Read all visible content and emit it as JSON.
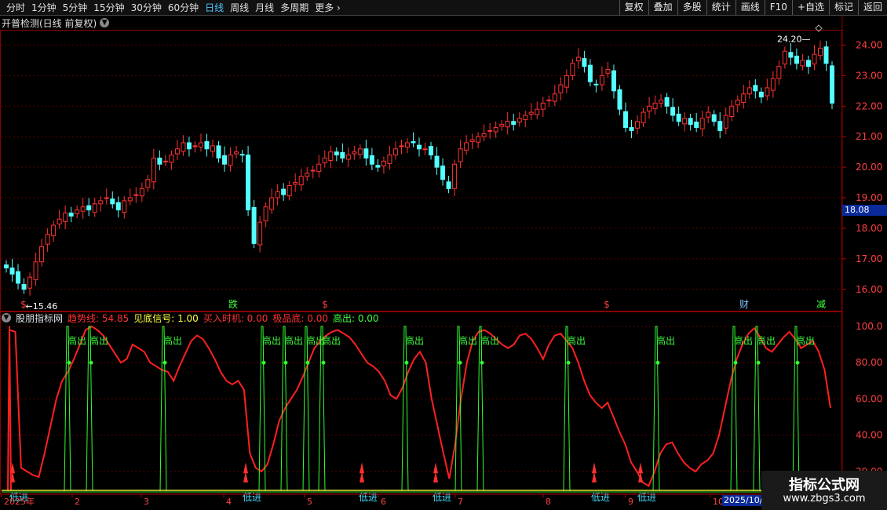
{
  "toolbar": {
    "periods": [
      "分时",
      "1分钟",
      "5分钟",
      "15分钟",
      "30分钟",
      "60分钟",
      "日线",
      "周线",
      "月线",
      "多周期",
      "更多"
    ],
    "selected_period": "日线",
    "tools": [
      "复权",
      "叠加",
      "多股",
      "统计",
      "画线",
      "F10",
      "+自选",
      "标记",
      "返回"
    ]
  },
  "title": {
    "name": "开普检测(日线 前复权)"
  },
  "price_axis": {
    "labels": [
      "24.00",
      "23.00",
      "22.00",
      "21.00",
      "20.00",
      "19.00",
      "18.00",
      "17.00",
      "16.00"
    ],
    "current_price": "18.08"
  },
  "annotations": {
    "high": "24.20",
    "low": "15.46"
  },
  "event_markers": [
    "$",
    "跌",
    "$",
    "$",
    "财",
    "减"
  ],
  "indicator": {
    "name": "股朋指标网",
    "fields": [
      {
        "label": "趋势线:",
        "value": "54.85",
        "color": "#ff3030"
      },
      {
        "label": "见底信号:",
        "value": "1.00",
        "color": "#ffff40"
      },
      {
        "label": "买入时机:",
        "value": "0.00",
        "color": "#ff3030"
      },
      {
        "label": "极品底:",
        "value": "0.00",
        "color": "#ff3030"
      },
      {
        "label": "高出:",
        "value": "0.00",
        "color": "#40ff40"
      }
    ],
    "axis_labels": [
      "100.0",
      "80.00",
      "60.00",
      "40.00",
      "20.00"
    ],
    "high_label": "高出",
    "low_label": "低进"
  },
  "date_axis": {
    "labels": [
      "2025年",
      "2",
      "3",
      "4",
      "5",
      "6",
      "7",
      "8",
      "9",
      "10"
    ],
    "current": "2025/10/"
  },
  "watermark": {
    "title": "指标公式网",
    "url": "www.zbgs3.com"
  },
  "chart_data": {
    "type": "candlestick",
    "price_range": [
      15.3,
      24.5
    ],
    "indicator_range": [
      10,
      100
    ],
    "closes": [
      16.7,
      16.5,
      16.2,
      16.0,
      16.4,
      16.9,
      17.4,
      17.8,
      18.1,
      18.3,
      18.5,
      18.4,
      18.6,
      18.7,
      18.6,
      18.8,
      18.9,
      19.0,
      18.8,
      18.6,
      18.9,
      19.0,
      19.1,
      19.3,
      19.6,
      20.3,
      20.1,
      20.2,
      20.4,
      20.6,
      20.8,
      20.6,
      20.7,
      20.8,
      20.6,
      20.7,
      20.3,
      20.1,
      20.4,
      20.5,
      20.4,
      18.6,
      17.5,
      18.2,
      18.7,
      19.0,
      19.2,
      19.1,
      19.4,
      19.5,
      19.7,
      19.8,
      19.9,
      20.1,
      20.3,
      20.5,
      20.4,
      20.3,
      20.4,
      20.5,
      20.6,
      20.3,
      20.1,
      20.0,
      20.2,
      20.4,
      20.6,
      20.7,
      20.8,
      20.8,
      20.6,
      20.6,
      20.4,
      20.0,
      19.6,
      19.3,
      20.1,
      20.6,
      20.8,
      20.9,
      21.0,
      21.1,
      21.2,
      21.3,
      21.4,
      21.5,
      21.4,
      21.6,
      21.7,
      21.8,
      21.9,
      22.1,
      22.2,
      22.4,
      22.7,
      23.0,
      23.4,
      23.6,
      23.3,
      22.8,
      22.7,
      23.0,
      23.2,
      22.5,
      21.9,
      21.3,
      21.2,
      21.5,
      21.8,
      22.0,
      22.1,
      22.2,
      22.0,
      21.7,
      21.5,
      21.6,
      21.4,
      21.3,
      21.6,
      21.8,
      21.5,
      21.2,
      21.7,
      22.0,
      22.2,
      22.4,
      22.6,
      22.5,
      22.3,
      22.6,
      22.9,
      23.3,
      23.8,
      23.6,
      23.4,
      23.5,
      23.3,
      23.7,
      23.9,
      23.4,
      22.1
    ],
    "trend_series": [
      98,
      97,
      22,
      20,
      18,
      17,
      30,
      45,
      60,
      70,
      75,
      82,
      90,
      98,
      100,
      98,
      95,
      90,
      85,
      80,
      82,
      90,
      88,
      86,
      80,
      78,
      76,
      75,
      70,
      78,
      85,
      92,
      95,
      93,
      88,
      82,
      75,
      70,
      68,
      70,
      65,
      30,
      22,
      20,
      24,
      35,
      48,
      55,
      60,
      65,
      72,
      80,
      88,
      92,
      95,
      97,
      98,
      96,
      94,
      90,
      85,
      80,
      78,
      75,
      70,
      62,
      60,
      66,
      75,
      82,
      86,
      80,
      60,
      45,
      30,
      16,
      35,
      60,
      80,
      92,
      97,
      98,
      96,
      93,
      90,
      88,
      90,
      95,
      96,
      93,
      88,
      82,
      90,
      95,
      96,
      92,
      88,
      80,
      70,
      62,
      58,
      55,
      58,
      50,
      42,
      35,
      25,
      20,
      14,
      12,
      20,
      30,
      35,
      36,
      30,
      25,
      22,
      20,
      24,
      26,
      30,
      40,
      55,
      70,
      82,
      90,
      96,
      99,
      94,
      88,
      86,
      90,
      94,
      97,
      93,
      88,
      90,
      92,
      86,
      76,
      55
    ]
  }
}
